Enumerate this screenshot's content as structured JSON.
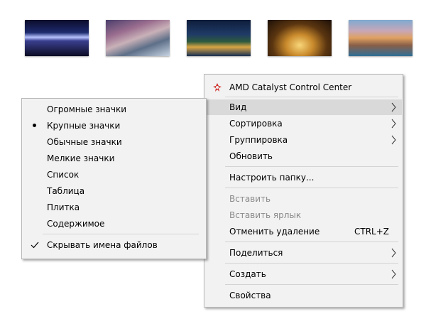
{
  "main_menu": {
    "items": [
      {
        "label": "AMD Catalyst Control Center",
        "icon": "amd-catalyst-icon"
      },
      {
        "label": "Вид",
        "submenu": true,
        "highlighted": true
      },
      {
        "label": "Сортировка",
        "submenu": true
      },
      {
        "label": "Группировка",
        "submenu": true
      },
      {
        "label": "Обновить"
      },
      {
        "label": "Настроить папку..."
      },
      {
        "label": "Вставить",
        "disabled": true
      },
      {
        "label": "Вставить ярлык",
        "disabled": true
      },
      {
        "label": "Отменить удаление",
        "shortcut": "CTRL+Z"
      },
      {
        "label": "Поделиться",
        "submenu": true
      },
      {
        "label": "Создать",
        "submenu": true
      },
      {
        "label": "Свойства"
      }
    ]
  },
  "view_submenu": {
    "items": [
      {
        "label": "Огромные значки"
      },
      {
        "label": "Крупные значки",
        "selected": true
      },
      {
        "label": "Обычные значки"
      },
      {
        "label": "Мелкие значки"
      },
      {
        "label": "Список"
      },
      {
        "label": "Таблица"
      },
      {
        "label": "Плитка"
      },
      {
        "label": "Содержимое"
      },
      {
        "label": "Скрывать имена файлов",
        "checked": true
      }
    ]
  },
  "thumbnails": [
    "thumbnail",
    "thumbnail",
    "thumbnail",
    "thumbnail",
    "thumbnail"
  ]
}
